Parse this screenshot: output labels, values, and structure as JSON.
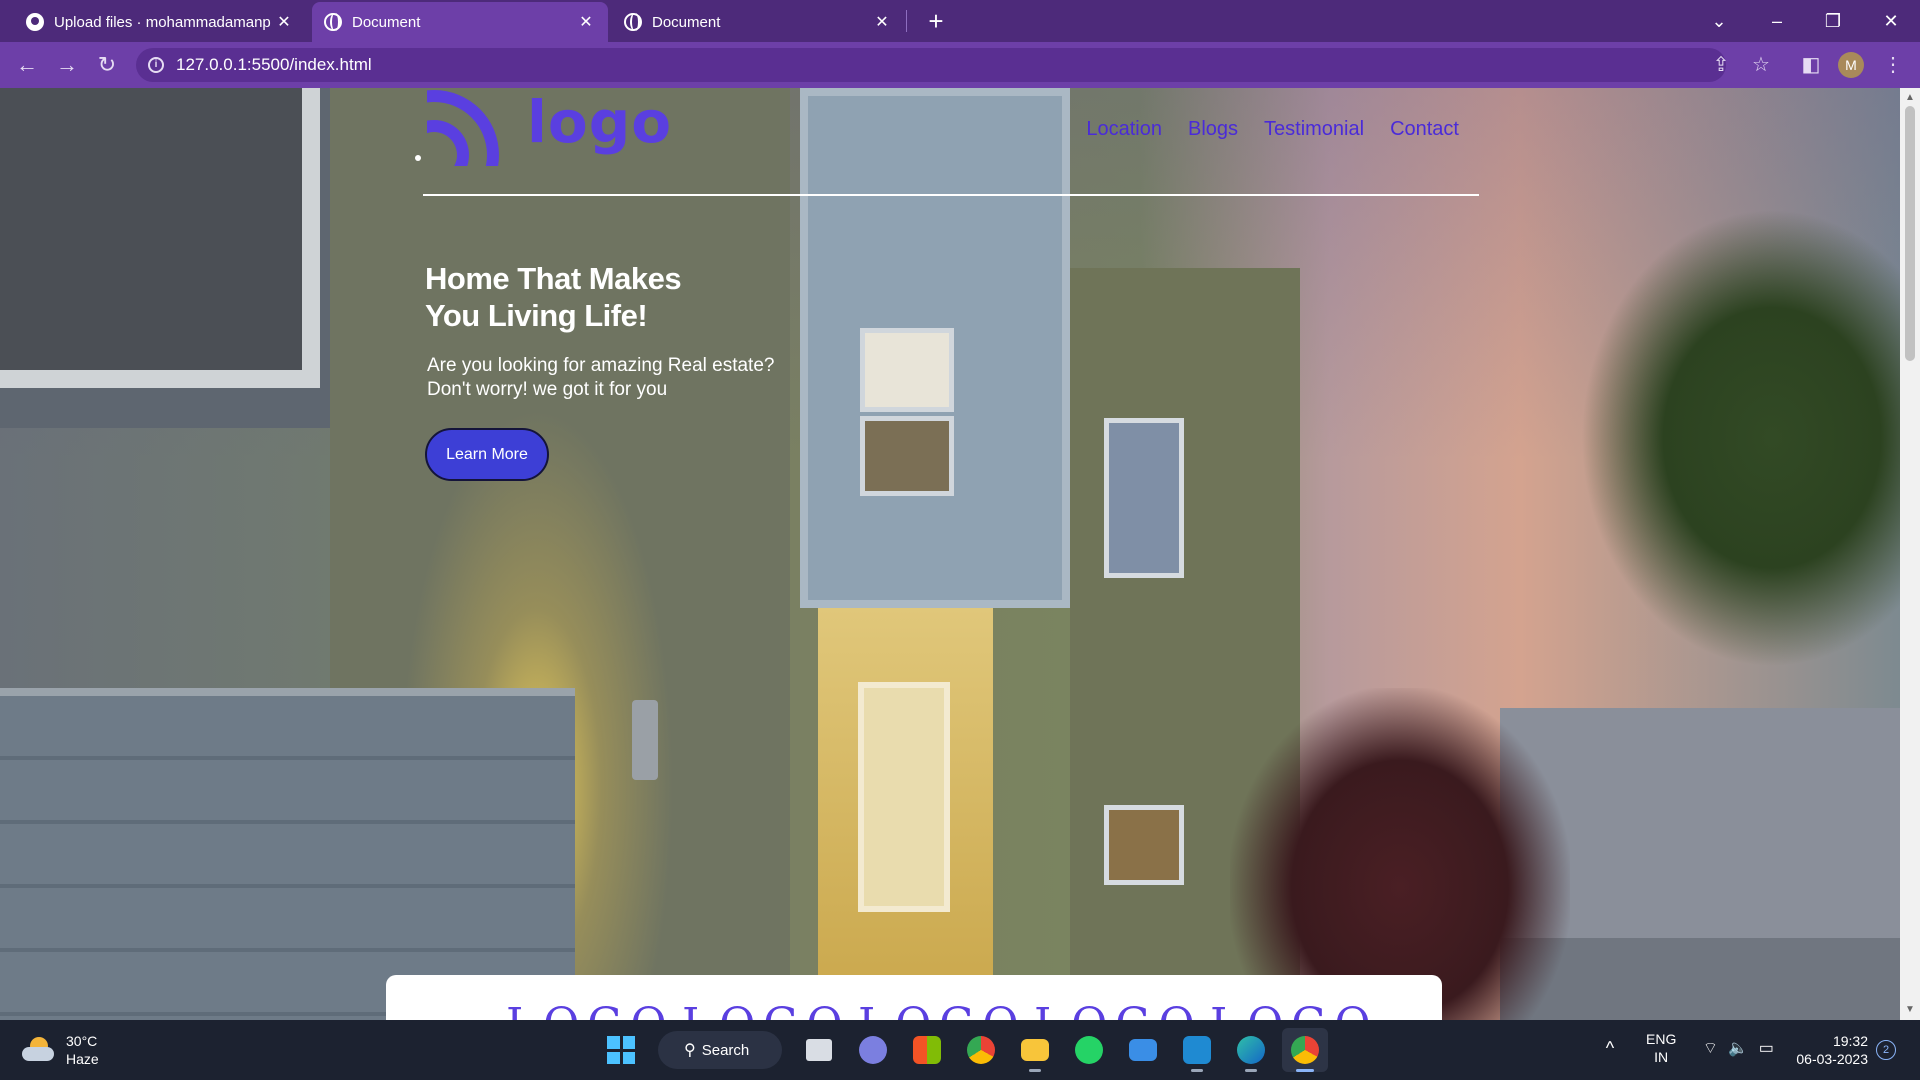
{
  "browser": {
    "tabs": [
      {
        "title": "Upload files · mohammadamanp",
        "close": "✕",
        "icon": "github-icon"
      },
      {
        "title": "Document",
        "close": "✕",
        "icon": "globe-icon"
      },
      {
        "title": "Document",
        "close": "✕",
        "icon": "globe-icon"
      }
    ],
    "new_tab": "+",
    "url": "127.0.0.1:5500/index.html",
    "profile_initial": "M",
    "window_controls": {
      "tab_search": "⌄",
      "minimize": "–",
      "restore": "❐",
      "close": "✕"
    },
    "toolbar_icons": {
      "back": "←",
      "forward": "→",
      "reload": "↻",
      "share": "⇪",
      "bookmark": "☆",
      "side_panel": "◧",
      "menu": "⋮",
      "info": "i"
    }
  },
  "site": {
    "logo_text": "logo",
    "nav": [
      "Location",
      "Blogs",
      "Testimonial",
      "Contact"
    ],
    "hero": {
      "title": "Home That Makes You Living Life!",
      "subtitle": "Are you looking for amazing Real estate? Don't worry! we got it for you",
      "cta": "Learn More"
    },
    "partner_logos": [
      "LOGO",
      "LOGO",
      "LOGO",
      "LOGO",
      "LOGO"
    ],
    "colors": {
      "accent": "#5a3fe0",
      "nav_link": "#4a2bd8",
      "button": "#3d3fd6"
    }
  },
  "taskbar": {
    "weather": {
      "temp": "30°C",
      "condition": "Haze"
    },
    "search_label": "Search",
    "apps": [
      "file-explorer-icon",
      "teams-icon",
      "store-icon",
      "chrome-icon",
      "folder-icon",
      "whatsapp-icon",
      "mail-icon",
      "vscode-icon",
      "edge-icon",
      "chrome-profile-icon"
    ],
    "language": {
      "line1": "ENG",
      "line2": "IN"
    },
    "time": "19:32",
    "date": "06-03-2023",
    "notifications": "2",
    "tray_chevron": "^"
  }
}
